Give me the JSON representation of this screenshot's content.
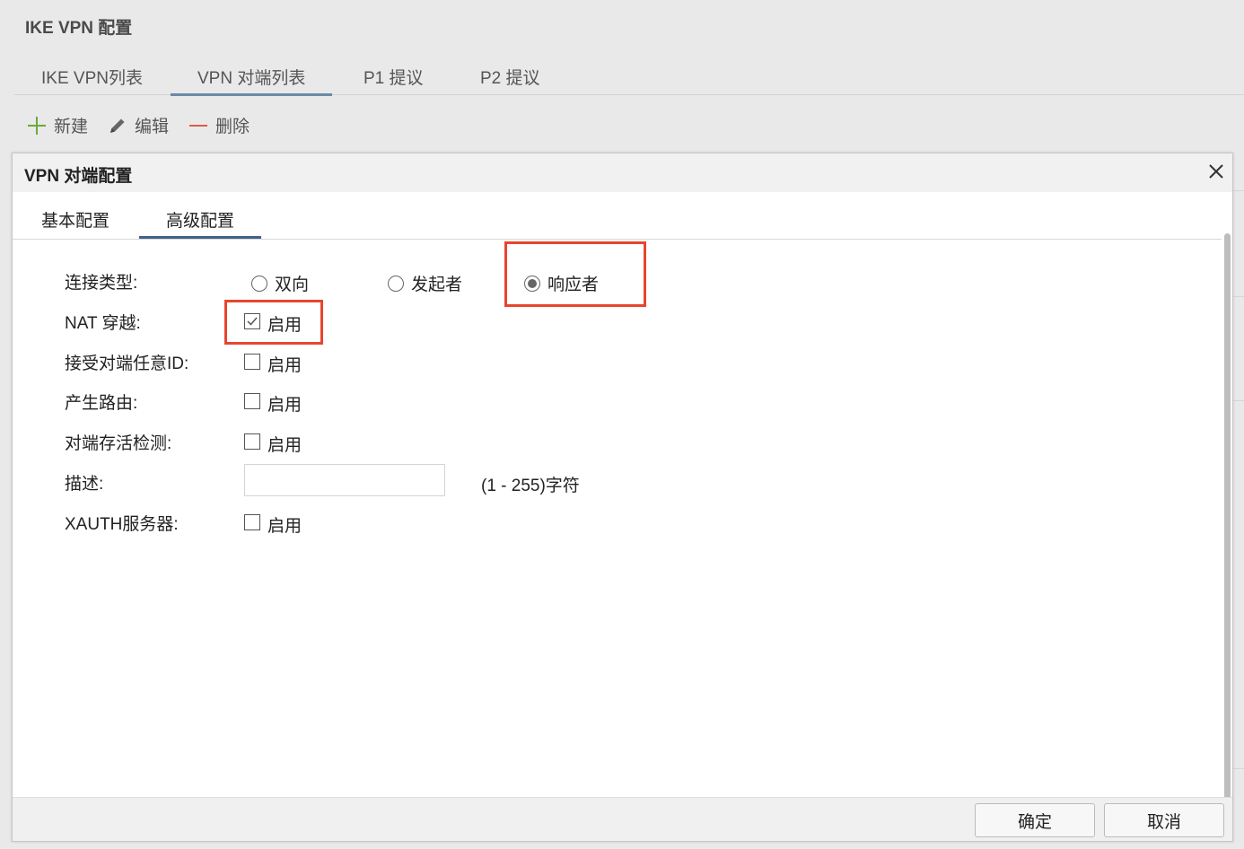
{
  "page": {
    "title": "IKE VPN 配置"
  },
  "main_tabs": [
    {
      "label": "IKE VPN列表",
      "active": false
    },
    {
      "label": "VPN 对端列表",
      "active": true
    },
    {
      "label": "P1 提议",
      "active": false
    },
    {
      "label": "P2 提议",
      "active": false
    }
  ],
  "toolbar": {
    "new_label": "新建",
    "edit_label": "编辑",
    "delete_label": "删除"
  },
  "dialog": {
    "title": "VPN 对端配置",
    "tabs": [
      {
        "label": "基本配置",
        "active": false
      },
      {
        "label": "高级配置",
        "active": true
      }
    ],
    "connection_type": {
      "label": "连接类型:",
      "options": [
        "双向",
        "发起者",
        "响应者"
      ],
      "selected": "响应者"
    },
    "nat_traversal": {
      "label": "NAT 穿越:",
      "option": "启用",
      "checked": true
    },
    "accept_any_peer_id": {
      "label": "接受对端任意ID:",
      "option": "启用",
      "checked": false
    },
    "generate_route": {
      "label": "产生路由:",
      "option": "启用",
      "checked": false
    },
    "peer_liveness": {
      "label": "对端存活检测:",
      "option": "启用",
      "checked": false
    },
    "description": {
      "label": "描述:",
      "value": "",
      "hint": "(1 - 255)字符"
    },
    "xauth_server": {
      "label": "XAUTH服务器:",
      "option": "启用",
      "checked": false
    },
    "ok_label": "确定",
    "cancel_label": "取消"
  },
  "colors": {
    "highlight": "#e8452e",
    "add_icon": "#6aaa3a",
    "delete_icon": "#e05a4a",
    "active_tab": "#3f6386"
  }
}
